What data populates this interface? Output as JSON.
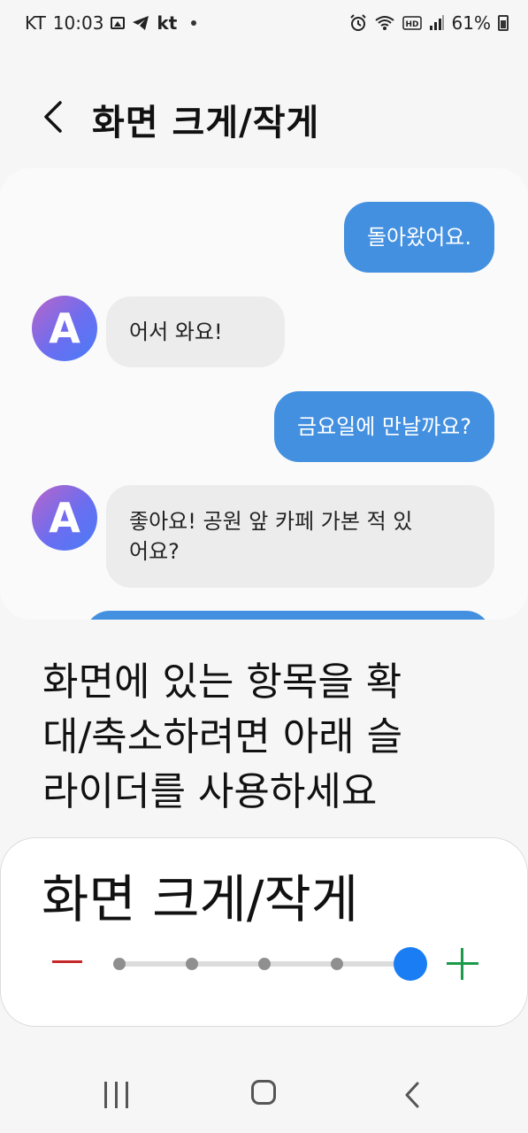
{
  "status_bar": {
    "carrier": "KT",
    "time": "10:03",
    "carrier_logo": "kt",
    "battery": "61%",
    "icons": [
      "image-icon",
      "telegram-icon",
      "alarm-icon",
      "wifi-icon",
      "hd-icon",
      "signal-icon",
      "battery-icon"
    ]
  },
  "header": {
    "title": "화면 크게/작게"
  },
  "preview": {
    "messages": [
      {
        "side": "out",
        "text": "돌아왔어요."
      },
      {
        "side": "in",
        "avatar": "A",
        "text": "어서 와요!"
      },
      {
        "side": "out",
        "text": "금요일에 만날까요?"
      },
      {
        "side": "in",
        "avatar": "A",
        "line1": "좋아요! 공원 앞 카페 가본 적 있",
        "line2": "어요?"
      }
    ]
  },
  "description": {
    "line1": "화면에 있는 항목을 확",
    "line2": "대/축소하려면 아래 슬",
    "line3": "라이더를 사용하세요"
  },
  "zoom_control": {
    "title": "화면 크게/작게",
    "steps": 5,
    "selected_step": 5,
    "accent_color": "#1a7df4",
    "minus_color": "#c62828",
    "plus_color": "#1b9a4a"
  },
  "nav_bar": {
    "icons": [
      "recents-icon",
      "home-icon",
      "back-icon"
    ]
  }
}
